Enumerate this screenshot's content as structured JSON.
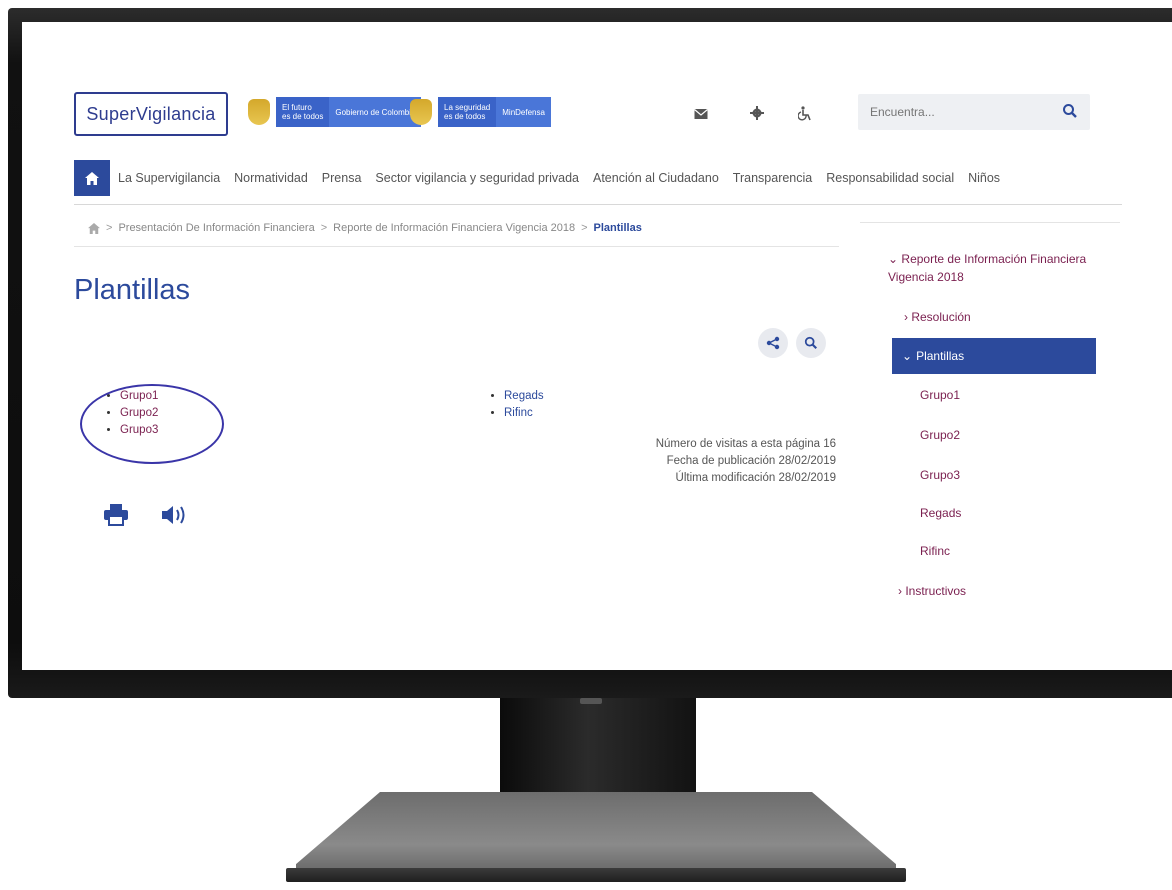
{
  "header": {
    "logo_text": "SuperVigilancia",
    "gov_badge_1": {
      "line1": "El futuro",
      "line2": "es de todos",
      "tag": "Gobierno de Colombia"
    },
    "gov_badge_2": {
      "line1": "La seguridad",
      "line2": "es de todos",
      "tag": "MinDefensa"
    },
    "icons": [
      "envelope-icon",
      "gear-icon",
      "accessibility-icon"
    ],
    "search": {
      "placeholder": "Encuentra..."
    }
  },
  "nav": {
    "items": [
      {
        "label": "La Supervigilancia"
      },
      {
        "label": "Normatividad"
      },
      {
        "label": "Prensa"
      },
      {
        "label": "Sector vigilancia y seguridad privada"
      },
      {
        "label": "Atención al Ciudadano"
      },
      {
        "label": "Transparencia"
      },
      {
        "label": "Responsabilidad social"
      },
      {
        "label": "Niños"
      }
    ]
  },
  "breadcrumb": {
    "sep": ">",
    "items": [
      {
        "label": "Presentación De Información Financiera"
      },
      {
        "label": "Reporte de Información Financiera Vigencia 2018"
      }
    ],
    "current": "Plantillas"
  },
  "page": {
    "title": "Plantillas",
    "left_links": [
      "Grupo1",
      "Grupo2",
      "Grupo3"
    ],
    "right_links": [
      "Regads",
      "Rifinc"
    ],
    "meta": {
      "visits": "Número de visitas a esta página 16",
      "published": "Fecha de publicación 28/02/2019",
      "modified": "Última modificación 28/02/2019"
    }
  },
  "sidebar": {
    "heading": "Reporte de Información Financiera Vigencia 2018",
    "heading_marker": "⌄",
    "resolucion": "Resolución",
    "active": "Plantillas",
    "sub_items": [
      "Grupo1",
      "Grupo2",
      "Grupo3",
      "Regads",
      "Rifinc"
    ],
    "instructivos": "Instructivos"
  },
  "colors": {
    "primary": "#2c4a9c",
    "link": "#7a1f4f",
    "annotation": "#3a35a8"
  }
}
